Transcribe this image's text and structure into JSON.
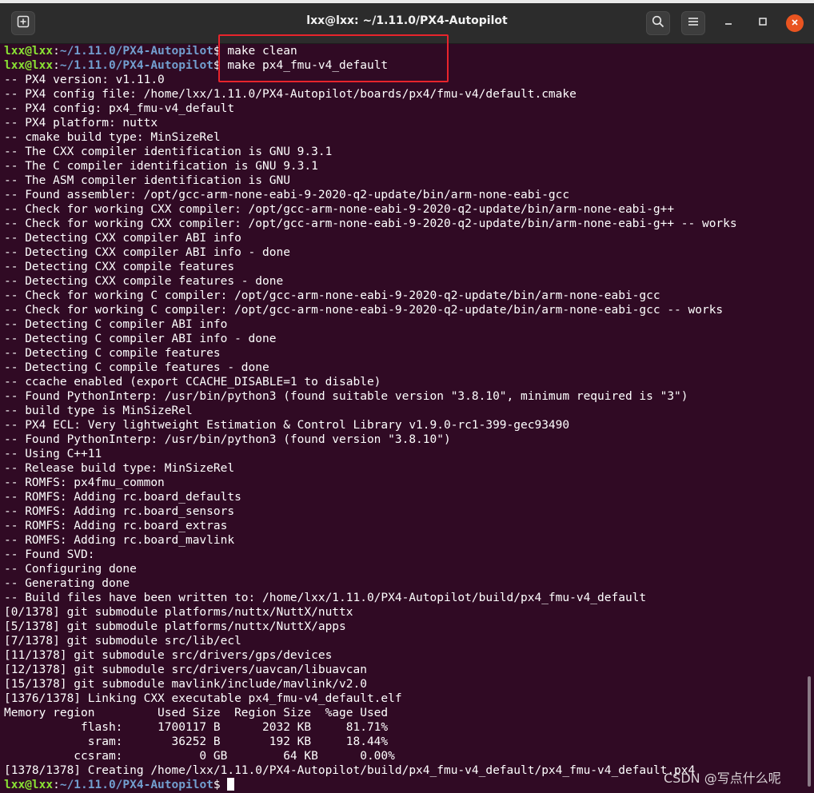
{
  "window": {
    "title": "lxx@lxx: ~/1.11.0/PX4-Autopilot"
  },
  "icons": {
    "new_tab": "new-tab-icon",
    "search": "search-icon",
    "menu": "hamburger-menu-icon",
    "minimize": "minimize-icon",
    "maximize": "maximize-icon",
    "close": "close-icon"
  },
  "colors": {
    "terminal_bg": "#300a24",
    "prompt_user": "#8ae234",
    "prompt_path": "#729fcf",
    "highlight_box": "#e8242c",
    "close_button": "#e95420"
  },
  "prompt": {
    "user": "lxx@lxx",
    "sep": ":",
    "path": "~/1.11.0/PX4-Autopilot",
    "symbol": "$"
  },
  "commands": [
    " make clean",
    " make px4_fmu-v4_default"
  ],
  "output": [
    "-- PX4 version: v1.11.0",
    "-- PX4 config file: /home/lxx/1.11.0/PX4-Autopilot/boards/px4/fmu-v4/default.cmake",
    "-- PX4 config: px4_fmu-v4_default",
    "-- PX4 platform: nuttx",
    "-- cmake build type: MinSizeRel",
    "-- The CXX compiler identification is GNU 9.3.1",
    "-- The C compiler identification is GNU 9.3.1",
    "-- The ASM compiler identification is GNU",
    "-- Found assembler: /opt/gcc-arm-none-eabi-9-2020-q2-update/bin/arm-none-eabi-gcc",
    "-- Check for working CXX compiler: /opt/gcc-arm-none-eabi-9-2020-q2-update/bin/arm-none-eabi-g++",
    "-- Check for working CXX compiler: /opt/gcc-arm-none-eabi-9-2020-q2-update/bin/arm-none-eabi-g++ -- works",
    "-- Detecting CXX compiler ABI info",
    "-- Detecting CXX compiler ABI info - done",
    "-- Detecting CXX compile features",
    "-- Detecting CXX compile features - done",
    "-- Check for working C compiler: /opt/gcc-arm-none-eabi-9-2020-q2-update/bin/arm-none-eabi-gcc",
    "-- Check for working C compiler: /opt/gcc-arm-none-eabi-9-2020-q2-update/bin/arm-none-eabi-gcc -- works",
    "-- Detecting C compiler ABI info",
    "-- Detecting C compiler ABI info - done",
    "-- Detecting C compile features",
    "-- Detecting C compile features - done",
    "-- ccache enabled (export CCACHE_DISABLE=1 to disable)",
    "-- Found PythonInterp: /usr/bin/python3 (found suitable version \"3.8.10\", minimum required is \"3\")",
    "-- build type is MinSizeRel",
    "-- PX4 ECL: Very lightweight Estimation & Control Library v1.9.0-rc1-399-gec93490",
    "-- Found PythonInterp: /usr/bin/python3 (found version \"3.8.10\")",
    "-- Using C++11",
    "-- Release build type: MinSizeRel",
    "-- ROMFS: px4fmu_common",
    "-- ROMFS: Adding rc.board_defaults",
    "-- ROMFS: Adding rc.board_sensors",
    "-- ROMFS: Adding rc.board_extras",
    "-- ROMFS: Adding rc.board_mavlink",
    "-- Found SVD:",
    "-- Configuring done",
    "-- Generating done",
    "-- Build files have been written to: /home/lxx/1.11.0/PX4-Autopilot/build/px4_fmu-v4_default",
    "[0/1378] git submodule platforms/nuttx/NuttX/nuttx",
    "[5/1378] git submodule platforms/nuttx/NuttX/apps",
    "[7/1378] git submodule src/lib/ecl",
    "[11/1378] git submodule src/drivers/gps/devices",
    "[12/1378] git submodule src/drivers/uavcan/libuavcan",
    "[15/1378] git submodule mavlink/include/mavlink/v2.0",
    "[1376/1378] Linking CXX executable px4_fmu-v4_default.elf",
    "Memory region         Used Size  Region Size  %age Used",
    "           flash:     1700117 B      2032 KB     81.71%",
    "            sram:       36252 B       192 KB     18.44%",
    "          ccsram:           0 GB        64 KB      0.00%",
    "[1378/1378] Creating /home/lxx/1.11.0/PX4-Autopilot/build/px4_fmu-v4_default/px4_fmu-v4_default.px4"
  ],
  "watermark": "CSDN @写点什么呢"
}
